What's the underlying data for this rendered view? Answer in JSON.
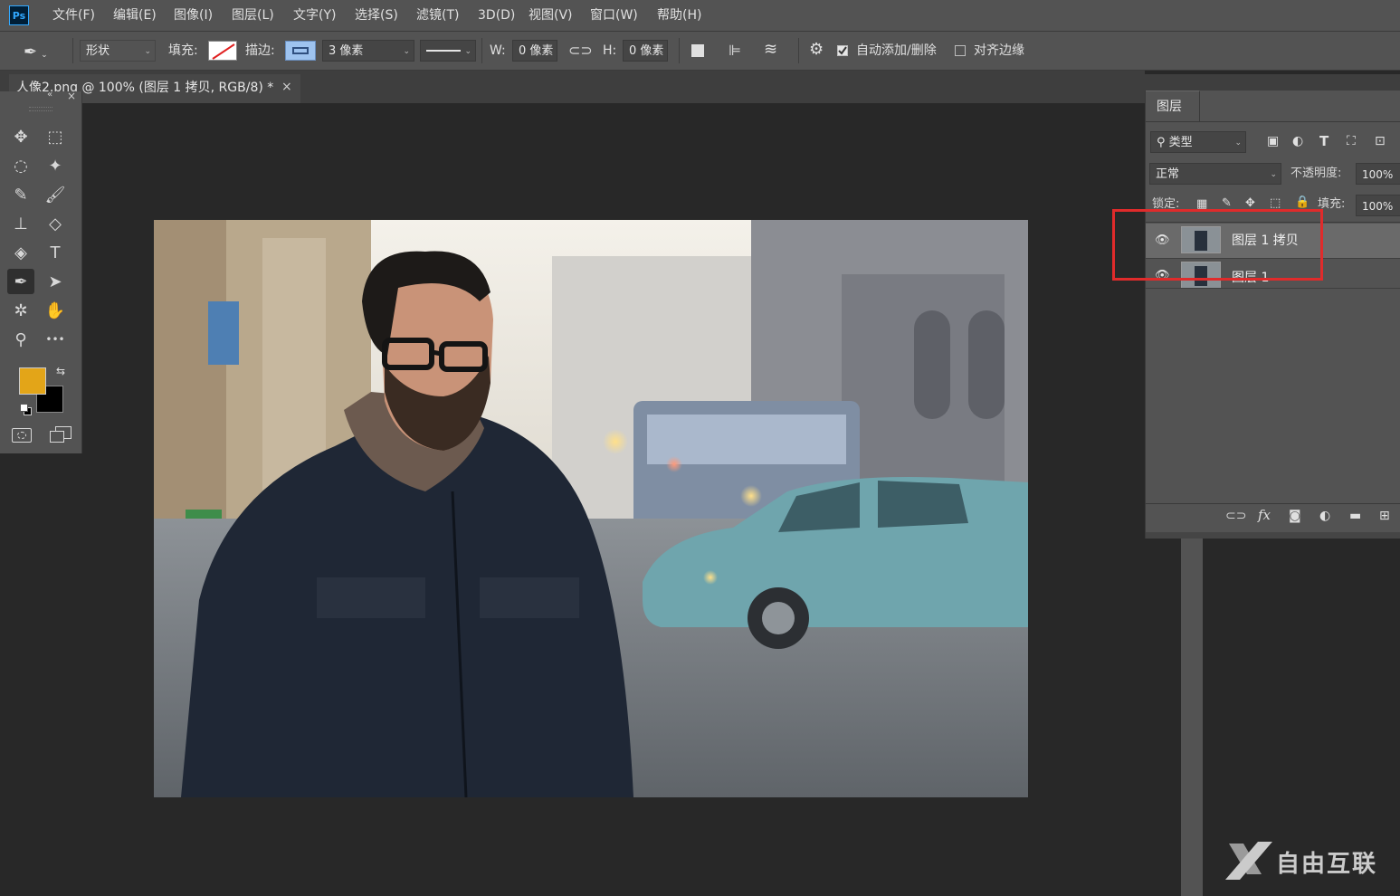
{
  "app": {
    "logo": "Ps"
  },
  "menu": [
    "文件(F)",
    "编辑(E)",
    "图像(I)",
    "图层(L)",
    "文字(Y)",
    "选择(S)",
    "滤镜(T)",
    "3D(D)",
    "视图(V)",
    "窗口(W)",
    "帮助(H)"
  ],
  "options": {
    "mode": "形状",
    "fill_label": "填充:",
    "stroke_label": "描边:",
    "stroke_width": "3 像素",
    "w_label": "W:",
    "w_value": "0 像素",
    "h_label": "H:",
    "h_value": "0 像素",
    "auto_add_delete": "自动添加/删除",
    "auto_add_delete_checked": true,
    "align_edges": "对齐边缘",
    "align_edges_checked": false
  },
  "document": {
    "tab_title": "人像2.png @ 100% (图层 1 拷贝, RGB/8) *",
    "close": "×"
  },
  "toolbox": {
    "close": "×",
    "collapse": "«",
    "foreground_color": "#e3a518",
    "background_color": "#000000",
    "tools": [
      {
        "icon": "move-icon",
        "glyph": "✥"
      },
      {
        "icon": "marquee-icon",
        "glyph": "⬚"
      },
      {
        "icon": "lasso-icon",
        "glyph": "◌"
      },
      {
        "icon": "magic-wand-icon",
        "glyph": "✦"
      },
      {
        "icon": "eyedropper-icon",
        "glyph": "✎"
      },
      {
        "icon": "brush-icon",
        "glyph": "🖌"
      },
      {
        "icon": "stamp-icon",
        "glyph": "⊥"
      },
      {
        "icon": "eraser-icon",
        "glyph": "◇"
      },
      {
        "icon": "paint-bucket-icon",
        "glyph": "◈"
      },
      {
        "icon": "type-icon",
        "glyph": "T"
      },
      {
        "icon": "pen-icon",
        "glyph": "✒",
        "selected": true
      },
      {
        "icon": "path-select-icon",
        "glyph": "➤"
      },
      {
        "icon": "custom-shape-icon",
        "glyph": "✲"
      },
      {
        "icon": "hand-icon",
        "glyph": "✋"
      },
      {
        "icon": "zoom-icon",
        "glyph": "⚲"
      },
      {
        "icon": "more-tools-icon",
        "glyph": "•••"
      }
    ]
  },
  "layers_panel": {
    "tab": "图层",
    "filter_label": "类型",
    "blend_mode": "正常",
    "opacity_label": "不透明度:",
    "opacity_value": "100%",
    "lock_label": "锁定:",
    "fill_label": "填充:",
    "fill_value": "100%",
    "layers": [
      {
        "name": "图层 1 拷贝",
        "visible": true,
        "selected": true
      },
      {
        "name": "图层 1",
        "visible": true,
        "selected": false
      }
    ],
    "highlight_color": "#e02b2b"
  },
  "watermark": "自由互联"
}
